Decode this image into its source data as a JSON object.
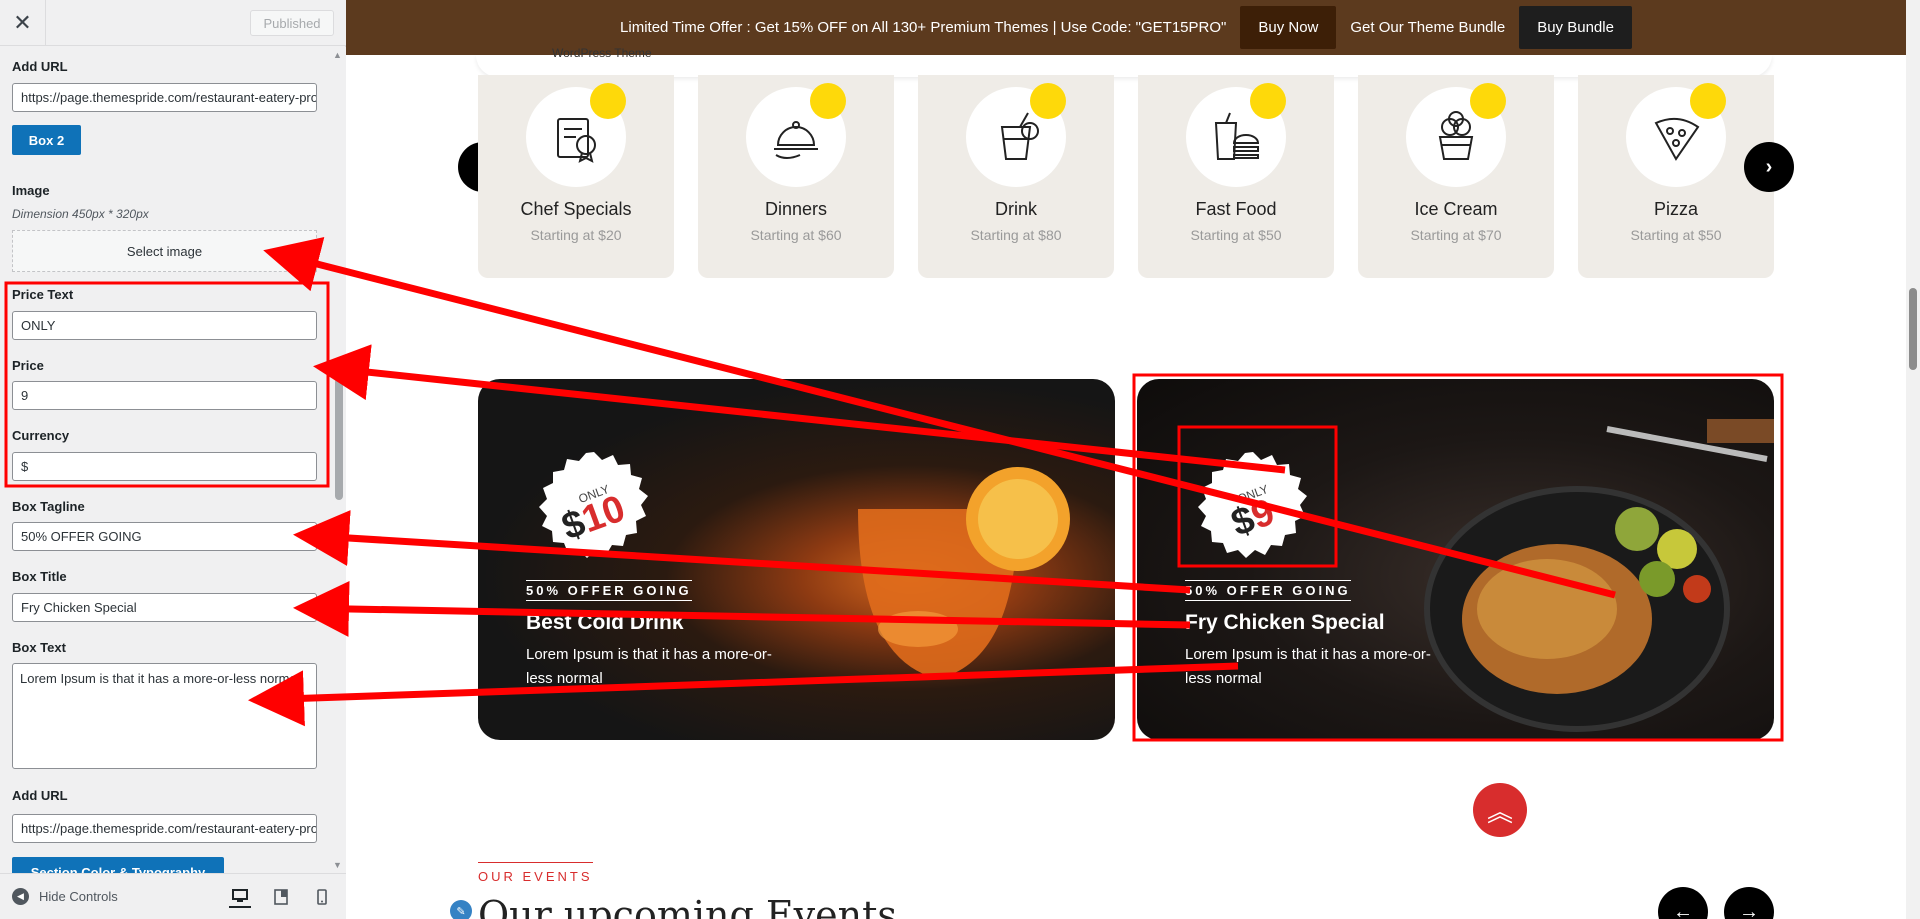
{
  "panel": {
    "close_icon": "close-icon",
    "publish_label": "Published",
    "add_url_label": "Add URL",
    "add_url_value": "https://page.themespride.com/restaurant-eatery-pro/",
    "box2_label": "Box 2",
    "image_label": "Image",
    "image_dimension": "Dimension 450px * 320px",
    "select_image_label": "Select image",
    "price_text_label": "Price Text",
    "price_text_value": "ONLY",
    "price_label": "Price",
    "price_value": "9",
    "currency_label": "Currency",
    "currency_value": "$",
    "tagline_label": "Box Tagline",
    "tagline_value": "50% OFFER GOING",
    "title_label": "Box Title",
    "title_value": "Fry Chicken Special",
    "text_label": "Box Text",
    "text_value": "Lorem Ipsum is that it has a more-or-less normal",
    "add_url2_label": "Add URL",
    "add_url2_value": "https://page.themespride.com/restaurant-eatery-pro/",
    "section_btn_label": "Section Color & Typography",
    "hide_controls_label": "Hide Controls"
  },
  "promo": {
    "text": "Limited Time Offer : Get 15% OFF on All 130+ Premium Themes | Use Code: \"GET15PRO\"",
    "buy_now": "Buy Now",
    "bundle_text": "Get Our Theme Bundle",
    "buy_bundle": "Buy Bundle"
  },
  "header": {
    "logo_text": "WordPress Theme"
  },
  "categories": [
    {
      "name": "Chef Specials",
      "price": "Starting at $20",
      "icon": "chef-hat-icon"
    },
    {
      "name": "Dinners",
      "price": "Starting at $60",
      "icon": "cloche-icon"
    },
    {
      "name": "Drink",
      "price": "Starting at $80",
      "icon": "drink-icon"
    },
    {
      "name": "Fast Food",
      "price": "Starting at $50",
      "icon": "burger-icon"
    },
    {
      "name": "Ice Cream",
      "price": "Starting at $70",
      "icon": "ice-cream-icon"
    },
    {
      "name": "Pizza",
      "price": "Starting at $50",
      "icon": "pizza-icon"
    }
  ],
  "banners": [
    {
      "only": "ONLY",
      "currency": "$",
      "price": "10",
      "tagline": "50% OFFER GOING",
      "title": "Best Cold Drink",
      "text": "Lorem Ipsum is that it has a more-or-less normal"
    },
    {
      "only": "ONLY",
      "currency": "$",
      "price": "9",
      "tagline": "50% OFFER GOING",
      "title": "Fry Chicken Special",
      "text": "Lorem Ipsum is that it has a more-or-less normal"
    }
  ],
  "events": {
    "label": "OUR EVENTS",
    "title": "Our upcoming Events"
  },
  "colors": {
    "promo_bg": "#5c3a1e",
    "accent_red": "#d82d2d",
    "customizer_blue": "#0f72b8",
    "category_dot": "#fed90a",
    "annotation_red": "#ff0000"
  }
}
